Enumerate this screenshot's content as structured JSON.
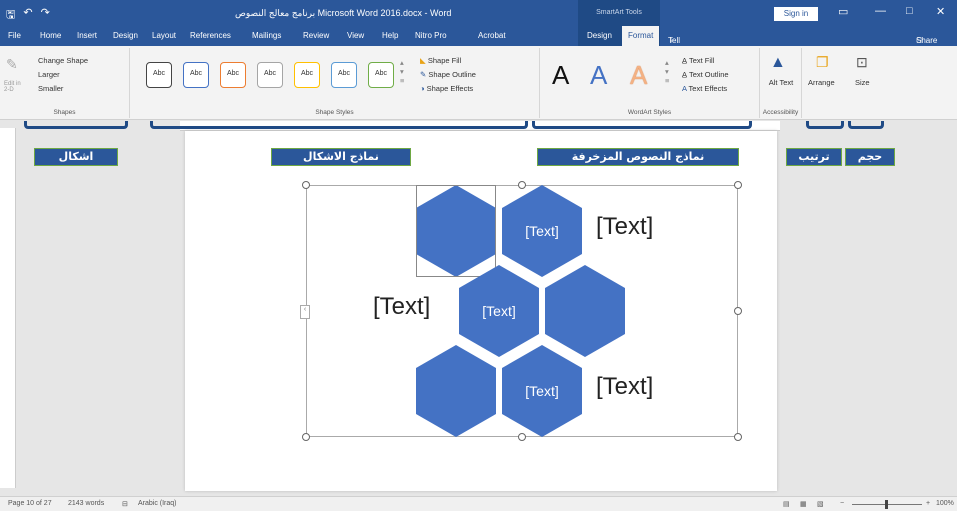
{
  "titlebar": {
    "quick_access": [
      "🖫",
      "↶",
      "↷"
    ],
    "title": "برنامج معالج النصوص Microsoft Word 2016.docx - Word",
    "smartart_tools": "SmartArt Tools",
    "sign_in": "Sign in"
  },
  "tabs": [
    "File",
    "Home",
    "Insert",
    "Design",
    "Layout",
    "References",
    "Mailings",
    "Review",
    "View",
    "Help",
    "Nitro Pro",
    "Acrobat",
    "Design",
    "Format"
  ],
  "tell_me": "Tell me what you want to do",
  "share": "Share",
  "ribbon": {
    "shapes": {
      "items": [
        "Change Shape",
        "Larger",
        "Smaller"
      ],
      "edit": "Edit in 2-D",
      "label": "Shapes"
    },
    "shape_styles": {
      "swatch": "Abc",
      "fill": "Shape Fill",
      "outline": "Shape Outline",
      "effects": "Shape Effects",
      "label": "Shape Styles"
    },
    "wordart": {
      "letter": "A",
      "fill": "Text Fill",
      "outline": "Text Outline",
      "effects": "Text Effects",
      "label": "WordArt Styles"
    },
    "accessibility": {
      "alt_text": "Alt Text",
      "label": "Accessibility"
    },
    "arrange": "Arrange",
    "size": "Size"
  },
  "callouts": {
    "shapes": "اشكال",
    "shape_styles": "نماذج الاشكال",
    "wordart": "نماذج النصوص المزخرفة",
    "arrange": "ترتيب",
    "size": "حجم"
  },
  "diagram": {
    "placeholder": "[Text]"
  },
  "status": {
    "page": "Page 10 of 27",
    "words": "2143 words",
    "language": "Arabic (Iraq)",
    "zoom": "100%"
  },
  "colors": {
    "accent": "#2b579a",
    "hex": "#4472c4",
    "callout_border": "#6ea843"
  }
}
